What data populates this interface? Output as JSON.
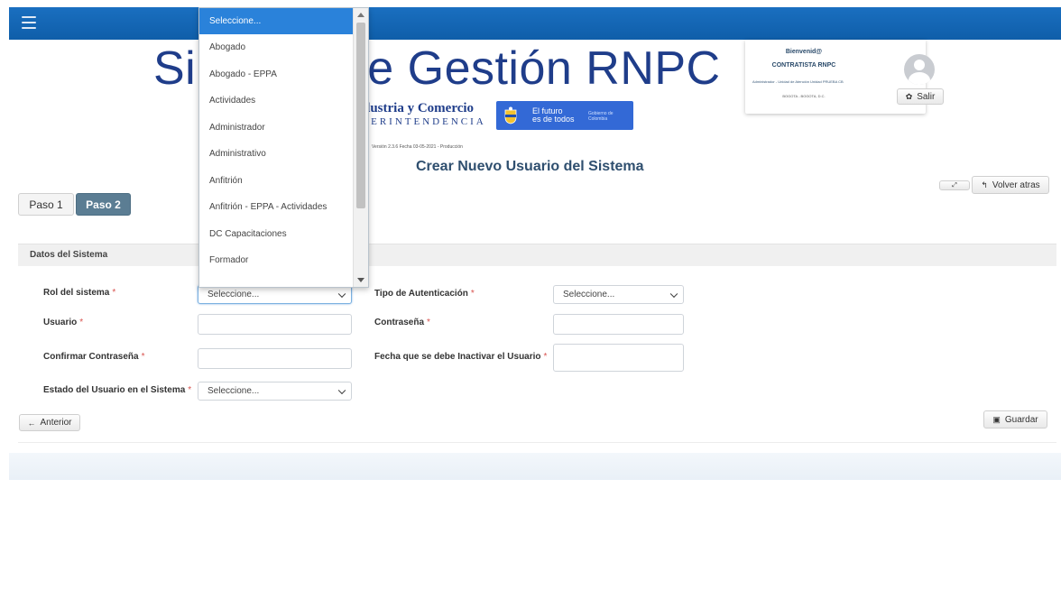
{
  "header": {
    "title": "Sistema de Gestión RNPC",
    "title_visible_left": "Si",
    "title_visible_right": "e Gestión RNPC",
    "org_name_visible": "dustria y Comercio",
    "org_sub_visible": "PERINTENDENCIA",
    "gov_logo": {
      "line1": "El futuro",
      "line2": "es de todos",
      "tag": "Gobierno de Colombia",
      "color": "#3369d6"
    },
    "version": "Versión 2.3.6 Fecha 03-05-2021 - Producción",
    "page_title": "Crear Nuevo Usuario del Sistema"
  },
  "topbar": {
    "color": "#0f5ea9",
    "menu_icon": "hamburger-icon"
  },
  "user_card": {
    "welcome": "Bienvenid@",
    "name": "CONTRATISTA RNPC",
    "role": "Administrador - Unidad de Atención Unidad PRUEBA CB",
    "city": "BOGOTA - BOGOTA, D.C.",
    "logout_label": "Salir"
  },
  "actions": {
    "volver_label": "Volver atras",
    "anterior_label": "Anterior",
    "guardar_label": "Guardar"
  },
  "steps": [
    {
      "label": "Paso 1",
      "active": false
    },
    {
      "label": "Paso 2",
      "active": true
    }
  ],
  "section": {
    "title": "Datos del Sistema"
  },
  "form": {
    "rol_label": "Rol del sistema",
    "rol_value": "Seleccione...",
    "usuario_label": "Usuario",
    "usuario_value": "",
    "confirmar_label": "Confirmar Contraseña",
    "confirmar_value": "",
    "estado_label": "Estado del Usuario en el Sistema",
    "estado_value": "Seleccione...",
    "tipo_auth_label": "Tipo de Autenticación",
    "tipo_auth_value": "Seleccione...",
    "contrasena_label": "Contraseña",
    "contrasena_value": "",
    "fecha_label": "Fecha que se debe Inactivar el Usuario",
    "fecha_value": "",
    "required_mark": "*"
  },
  "rol_dropdown": {
    "options": [
      "Seleccione...",
      "Abogado",
      "Abogado - EPPA",
      "Actividades",
      "Administrador",
      "Administrativo",
      "Anfitrión",
      "Anfitrión - EPPA - Actividades",
      "DC Capacitaciones",
      "Formador"
    ],
    "selected_index": 0,
    "highlight_color": "#2a82da"
  }
}
